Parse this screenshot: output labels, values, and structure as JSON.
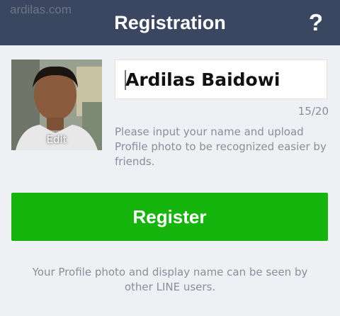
{
  "header": {
    "watermark": "ardilas.com",
    "title": "Registration",
    "help_label": "?"
  },
  "profile": {
    "photo_action_label": "Edit",
    "name_value": "Ardilas Baidowi",
    "char_counter": "15/20",
    "hint": "Please input your name and upload Profile photo to be recognized easier by friends."
  },
  "actions": {
    "register_label": "Register"
  },
  "footer": {
    "note": "Your Profile photo and display name can be seen by other LINE users."
  },
  "colors": {
    "header_bg": "#3b4660",
    "accent_green": "#15b50d",
    "page_bg": "#eff0f4"
  }
}
